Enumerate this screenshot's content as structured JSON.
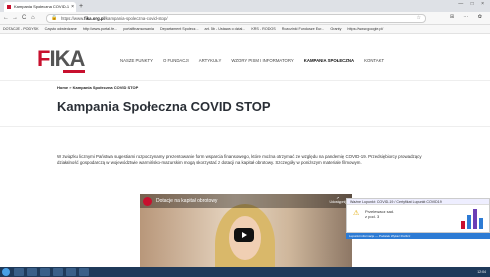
{
  "browser": {
    "tab_title": "Kampania Społeczna COVID-1",
    "tab_close": "×",
    "new_tab": "+",
    "window_controls": "— □ ×",
    "url_host": "fika.org.pl",
    "url_prefix": "https://www.",
    "url_path": "/kampania-spoleczna-covid-stop/",
    "url_icons": "☆",
    "toolbar_icons": "⊞ ⋯ ✿",
    "nav_back": "←",
    "nav_forward": "→",
    "nav_reload": "C",
    "nav_home": "⌂",
    "bookmarks": [
      "DOTACJE - PODYSK",
      "Często odwiedzane",
      "http://www.portal.fe...",
      "portalfinansowania",
      "Departament Społecz...",
      "art. 5b - Ustawa o dział...",
      "KRS - RODOS",
      "Rozczinki Fundusze Eur...",
      "Granty",
      "https://www.google.pl/"
    ]
  },
  "site": {
    "logo_f": "F",
    "logo_rest": "IKA",
    "nav": [
      "NASZE PUNKTY",
      "O FUNDACJI",
      "ARTYKUŁY",
      "WZORY PISM I INFORMATORY",
      "KAMPANIA SPOŁECZNA",
      "KONTAKT"
    ],
    "breadcrumb_home": "Home",
    "breadcrumb_sep": "»",
    "breadcrumb_current": "Kampania Społeczna COVID STOP",
    "page_title": "Kampania Społeczna COVID STOP",
    "body_text": "W związku licznymi Państwa sugestiami rozpoczynamy prezentowanie form wsparcia finansowego, które można otrzymać ze względu na pandemię COVID-19. Przedsiębiorcy prowadzący działalność gospodarczą w województwie warmińsko-mazurskim mogą skorzystać z dotacji na kapitał obrotowy. Szczegóły w poniższym materiale filmowym.",
    "video": {
      "title": "Dotacje na kapitał obrotowy",
      "share_label": "Udostępnij"
    }
  },
  "notification": {
    "header": "Ważne Lupunkt: COVID-19 / Certyfikat Lupunkt COVID19",
    "text_line1": "Przelewacz sad.",
    "text_line2": "z pod. 3"
  },
  "status_bar": "Lupunkt informacje  —  Podatek Wykaz   Rozlicz",
  "taskbar": {
    "clock": "12:04"
  },
  "colors": {
    "brand_red": "#c8102e",
    "title_text": "#2a2f36"
  }
}
